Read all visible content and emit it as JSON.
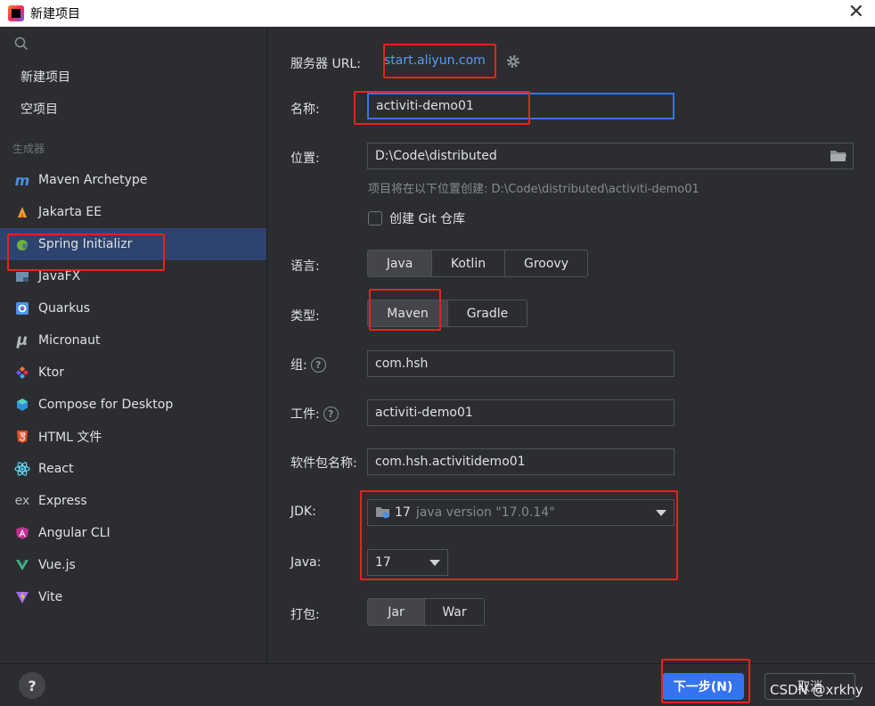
{
  "window": {
    "title": "新建项目",
    "close_symbol": "✕"
  },
  "sidebar": {
    "top_items": [
      {
        "label": "新建项目"
      },
      {
        "label": "空项目"
      }
    ],
    "section_label": "生成器",
    "generators": [
      {
        "label": "Maven Archetype",
        "icon": "maven-icon"
      },
      {
        "label": "Jakarta EE",
        "icon": "jakarta-icon"
      },
      {
        "label": "Spring Initializr",
        "icon": "spring-icon",
        "selected": true
      },
      {
        "label": "JavaFX",
        "icon": "javafx-icon"
      },
      {
        "label": "Quarkus",
        "icon": "quarkus-icon"
      },
      {
        "label": "Micronaut",
        "icon": "micronaut-icon"
      },
      {
        "label": "Ktor",
        "icon": "ktor-icon"
      },
      {
        "label": "Compose for Desktop",
        "icon": "compose-icon"
      },
      {
        "label": "HTML 文件",
        "icon": "html5-icon"
      },
      {
        "label": "React",
        "icon": "react-icon"
      },
      {
        "label": "Express",
        "icon": "express-icon"
      },
      {
        "label": "Angular CLI",
        "icon": "angular-icon"
      },
      {
        "label": "Vue.js",
        "icon": "vue-icon"
      },
      {
        "label": "Vite",
        "icon": "vite-icon"
      }
    ]
  },
  "form": {
    "server_url_label": "服务器 URL:",
    "server_url": "start.aliyun.com",
    "name_label": "名称:",
    "name_value": "activiti-demo01",
    "location_label": "位置:",
    "location_value": "D:\\Code\\distributed",
    "location_hint": "项目将在以下位置创建: D:\\Code\\distributed\\activiti-demo01",
    "git_checkbox_label": "创建 Git 仓库",
    "language_label": "语言:",
    "languages": [
      "Java",
      "Kotlin",
      "Groovy"
    ],
    "language_selected": "Java",
    "type_label": "类型:",
    "types": [
      "Maven",
      "Gradle"
    ],
    "type_selected": "Maven",
    "group_label": "组:",
    "group_value": "com.hsh",
    "artifact_label": "工件:",
    "artifact_value": "activiti-demo01",
    "package_label": "软件包名称:",
    "package_value": "com.hsh.activitidemo01",
    "jdk_label": "JDK:",
    "jdk_version": "17",
    "jdk_detail": "java version \"17.0.14\"",
    "java_label": "Java:",
    "java_value": "17",
    "packaging_label": "打包:",
    "packagings": [
      "Jar",
      "War"
    ],
    "packaging_selected": "Jar"
  },
  "footer": {
    "help_symbol": "?",
    "next_label": "下一步(N)",
    "cancel_label": "取消",
    "watermark": "CSDN @xrkhy"
  },
  "colors": {
    "accent": "#3574f0",
    "link": "#589df6",
    "annotation": "#e8231b",
    "selected_bg": "#2e436e"
  }
}
